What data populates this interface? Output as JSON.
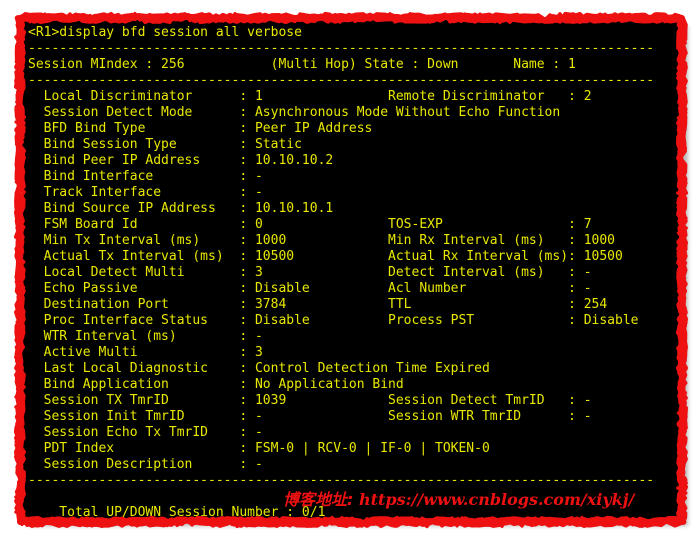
{
  "window": {
    "background_color": "#000000",
    "text_color": "#e8e800",
    "border_color": "#ee1111",
    "watermark_color": "#ee1111"
  },
  "terminal": {
    "prompt": "<R1>",
    "command": "display bfd session all verbose",
    "command_line": "<R1>display bfd session all verbose",
    "separator": "--------------------------------------------------------------------------------",
    "session_header": {
      "mindex_label": "Session MIndex",
      "mindex_value": "256",
      "hop_type": "(Multi Hop)",
      "state_label": "State",
      "state_value": "Down",
      "name_label": "Name",
      "name_value": "1",
      "line": "Session MIndex : 256           (Multi Hop) State : Down       Name : 1"
    },
    "detail_lines": [
      "  Local Discriminator      : 1                Remote Discriminator   : 2",
      "  Session Detect Mode      : Asynchronous Mode Without Echo Function",
      "  BFD Bind Type            : Peer IP Address",
      "  Bind Session Type        : Static",
      "  Bind Peer IP Address     : 10.10.10.2",
      "  Bind Interface           : -",
      "  Track Interface          : -",
      "  Bind Source IP Address   : 10.10.10.1",
      "  FSM Board Id             : 0                TOS-EXP                : 7",
      "  Min Tx Interval (ms)     : 1000             Min Rx Interval (ms)   : 1000",
      "  Actual Tx Interval (ms)  : 10500            Actual Rx Interval (ms): 10500",
      "  Local Detect Multi       : 3                Detect Interval (ms)   : -",
      "  Echo Passive             : Disable          Acl Number             : -",
      "  Destination Port         : 3784             TTL                    : 254",
      "  Proc Interface Status    : Disable          Process PST            : Disable",
      "  WTR Interval (ms)        : -",
      "  Active Multi             : 3",
      "  Last Local Diagnostic    : Control Detection Time Expired",
      "  Bind Application         : No Application Bind",
      "  Session TX TmrID         : 1039             Session Detect TmrID   : -",
      "  Session Init TmrID       : -                Session WTR TmrID      : -",
      "  Session Echo Tx TmrID    : -",
      "  PDT Index                : FSM-0 | RCV-0 | IF-0 | TOKEN-0",
      "  Session Description      : -"
    ],
    "fields": [
      {
        "label": "Local Discriminator",
        "value": "1",
        "label2": "Remote Discriminator",
        "value2": "2"
      },
      {
        "label": "Session Detect Mode",
        "value": "Asynchronous Mode Without Echo Function",
        "label2": "",
        "value2": ""
      },
      {
        "label": "BFD Bind Type",
        "value": "Peer IP Address",
        "label2": "",
        "value2": ""
      },
      {
        "label": "Bind Session Type",
        "value": "Static",
        "label2": "",
        "value2": ""
      },
      {
        "label": "Bind Peer IP Address",
        "value": "10.10.10.2",
        "label2": "",
        "value2": ""
      },
      {
        "label": "Bind Interface",
        "value": "-",
        "label2": "",
        "value2": ""
      },
      {
        "label": "Track Interface",
        "value": "-",
        "label2": "",
        "value2": ""
      },
      {
        "label": "Bind Source IP Address",
        "value": "10.10.10.1",
        "label2": "",
        "value2": ""
      },
      {
        "label": "FSM Board Id",
        "value": "0",
        "label2": "TOS-EXP",
        "value2": "7"
      },
      {
        "label": "Min Tx Interval (ms)",
        "value": "1000",
        "label2": "Min Rx Interval (ms)",
        "value2": "1000"
      },
      {
        "label": "Actual Tx Interval (ms)",
        "value": "10500",
        "label2": "Actual Rx Interval (ms)",
        "value2": "10500"
      },
      {
        "label": "Local Detect Multi",
        "value": "3",
        "label2": "Detect Interval (ms)",
        "value2": "-"
      },
      {
        "label": "Echo Passive",
        "value": "Disable",
        "label2": "Acl Number",
        "value2": "-"
      },
      {
        "label": "Destination Port",
        "value": "3784",
        "label2": "TTL",
        "value2": "254"
      },
      {
        "label": "Proc Interface Status",
        "value": "Disable",
        "label2": "Process PST",
        "value2": "Disable"
      },
      {
        "label": "WTR Interval (ms)",
        "value": "-",
        "label2": "",
        "value2": ""
      },
      {
        "label": "Active Multi",
        "value": "3",
        "label2": "",
        "value2": ""
      },
      {
        "label": "Last Local Diagnostic",
        "value": "Control Detection Time Expired",
        "label2": "",
        "value2": ""
      },
      {
        "label": "Bind Application",
        "value": "No Application Bind",
        "label2": "",
        "value2": ""
      },
      {
        "label": "Session TX TmrID",
        "value": "1039",
        "label2": "Session Detect TmrID",
        "value2": "-"
      },
      {
        "label": "Session Init TmrID",
        "value": "-",
        "label2": "Session WTR TmrID",
        "value2": "-"
      },
      {
        "label": "Session Echo Tx TmrID",
        "value": "-",
        "label2": "",
        "value2": ""
      },
      {
        "label": "PDT Index",
        "value": "FSM-0 | RCV-0 | IF-0 | TOKEN-0",
        "label2": "",
        "value2": ""
      },
      {
        "label": "Session Description",
        "value": "-",
        "label2": "",
        "value2": ""
      }
    ],
    "summary": {
      "label": "Total UP/DOWN Session Number",
      "value": "0/1",
      "line": "    Total UP/DOWN Session Number : 0/1"
    },
    "screen": "<R1>display bfd session all verbose\n--------------------------------------------------------------------------------\nSession MIndex : 256           (Multi Hop) State : Down       Name : 1\n--------------------------------------------------------------------------------\n  Local Discriminator      : 1                Remote Discriminator   : 2\n  Session Detect Mode      : Asynchronous Mode Without Echo Function\n  BFD Bind Type            : Peer IP Address\n  Bind Session Type        : Static\n  Bind Peer IP Address     : 10.10.10.2\n  Bind Interface           : -\n  Track Interface          : -\n  Bind Source IP Address   : 10.10.10.1\n  FSM Board Id             : 0                TOS-EXP                : 7\n  Min Tx Interval (ms)     : 1000             Min Rx Interval (ms)   : 1000\n  Actual Tx Interval (ms)  : 10500            Actual Rx Interval (ms): 10500\n  Local Detect Multi       : 3                Detect Interval (ms)   : -\n  Echo Passive             : Disable          Acl Number             : -\n  Destination Port         : 3784             TTL                    : 254\n  Proc Interface Status    : Disable          Process PST            : Disable\n  WTR Interval (ms)        : -\n  Active Multi             : 3\n  Last Local Diagnostic    : Control Detection Time Expired\n  Bind Application         : No Application Bind\n  Session TX TmrID         : 1039             Session Detect TmrID   : -\n  Session Init TmrID       : -                Session WTR TmrID      : -\n  Session Echo Tx TmrID    : -\n  PDT Index                : FSM-0 | RCV-0 | IF-0 | TOKEN-0\n  Session Description      : -\n--------------------------------------------------------------------------------\n\n    Total UP/DOWN Session Number : 0/1"
  },
  "watermark": {
    "prefix": "博客地址: ",
    "url": "https://www.cnblogs.com/xiykj/",
    "full": "博客地址: https://www.cnblogs.com/xiykj/"
  }
}
